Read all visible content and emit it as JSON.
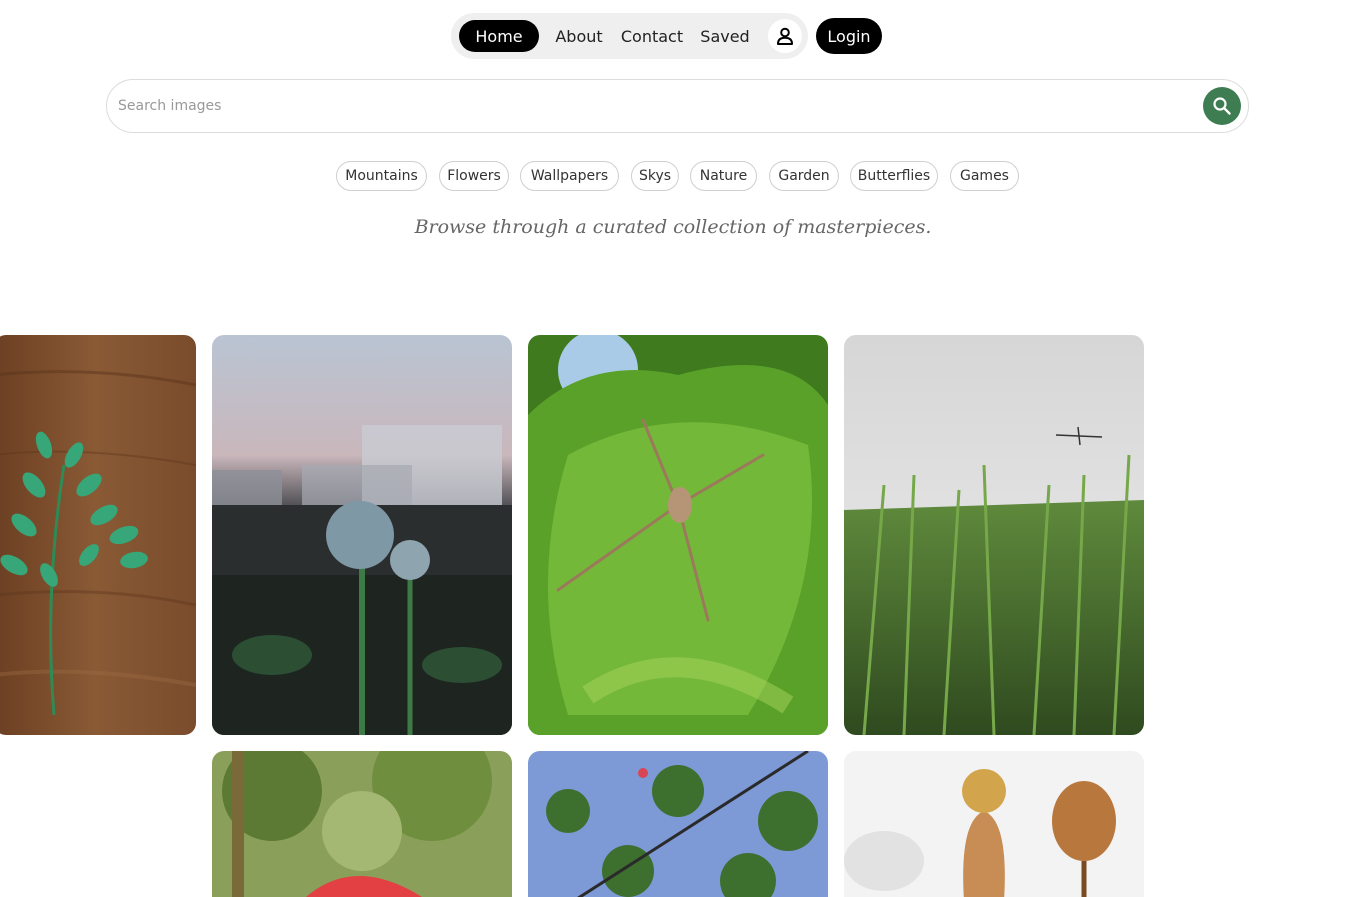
{
  "nav": {
    "home": "Home",
    "about": "About",
    "contact": "Contact",
    "saved": "Saved",
    "user_icon": "user-icon",
    "login": "Login"
  },
  "search": {
    "placeholder": "Search images",
    "value": "",
    "button_icon": "search-icon"
  },
  "tags": [
    "Mountains",
    "Flowers",
    "Wallpapers",
    "Skys",
    "Nature",
    "Garden",
    "Butterflies",
    "Games"
  ],
  "tagline": "Browse through a curated collection of masterpieces.",
  "colors": {
    "accent": "#3e7c52",
    "nav_active": "#000000",
    "nav_pill_bg": "#efefef"
  }
}
